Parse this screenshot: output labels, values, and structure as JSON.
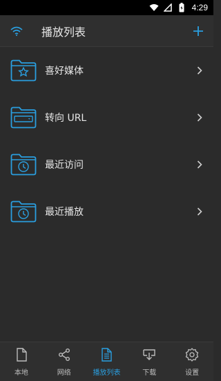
{
  "status_bar": {
    "time": "4:29"
  },
  "app_bar": {
    "title": "播放列表"
  },
  "list": {
    "items": [
      {
        "label": "喜好媒体",
        "icon": "star-folder-icon"
      },
      {
        "label": "转向 URL",
        "icon": "url-folder-icon"
      },
      {
        "label": "最近访问",
        "icon": "clock-folder-icon"
      },
      {
        "label": "最近播放",
        "icon": "clock-folder-icon"
      }
    ]
  },
  "bottom_nav": {
    "items": [
      {
        "label": "本地",
        "icon": "file-icon"
      },
      {
        "label": "网络",
        "icon": "share-icon"
      },
      {
        "label": "播放列表",
        "icon": "list-file-icon",
        "active": true
      },
      {
        "label": "下载",
        "icon": "download-icon"
      },
      {
        "label": "设置",
        "icon": "gear-icon"
      }
    ]
  },
  "colors": {
    "accent": "#2a9fe0",
    "background": "#2b2b2b",
    "bar": "#2f2f2f"
  }
}
